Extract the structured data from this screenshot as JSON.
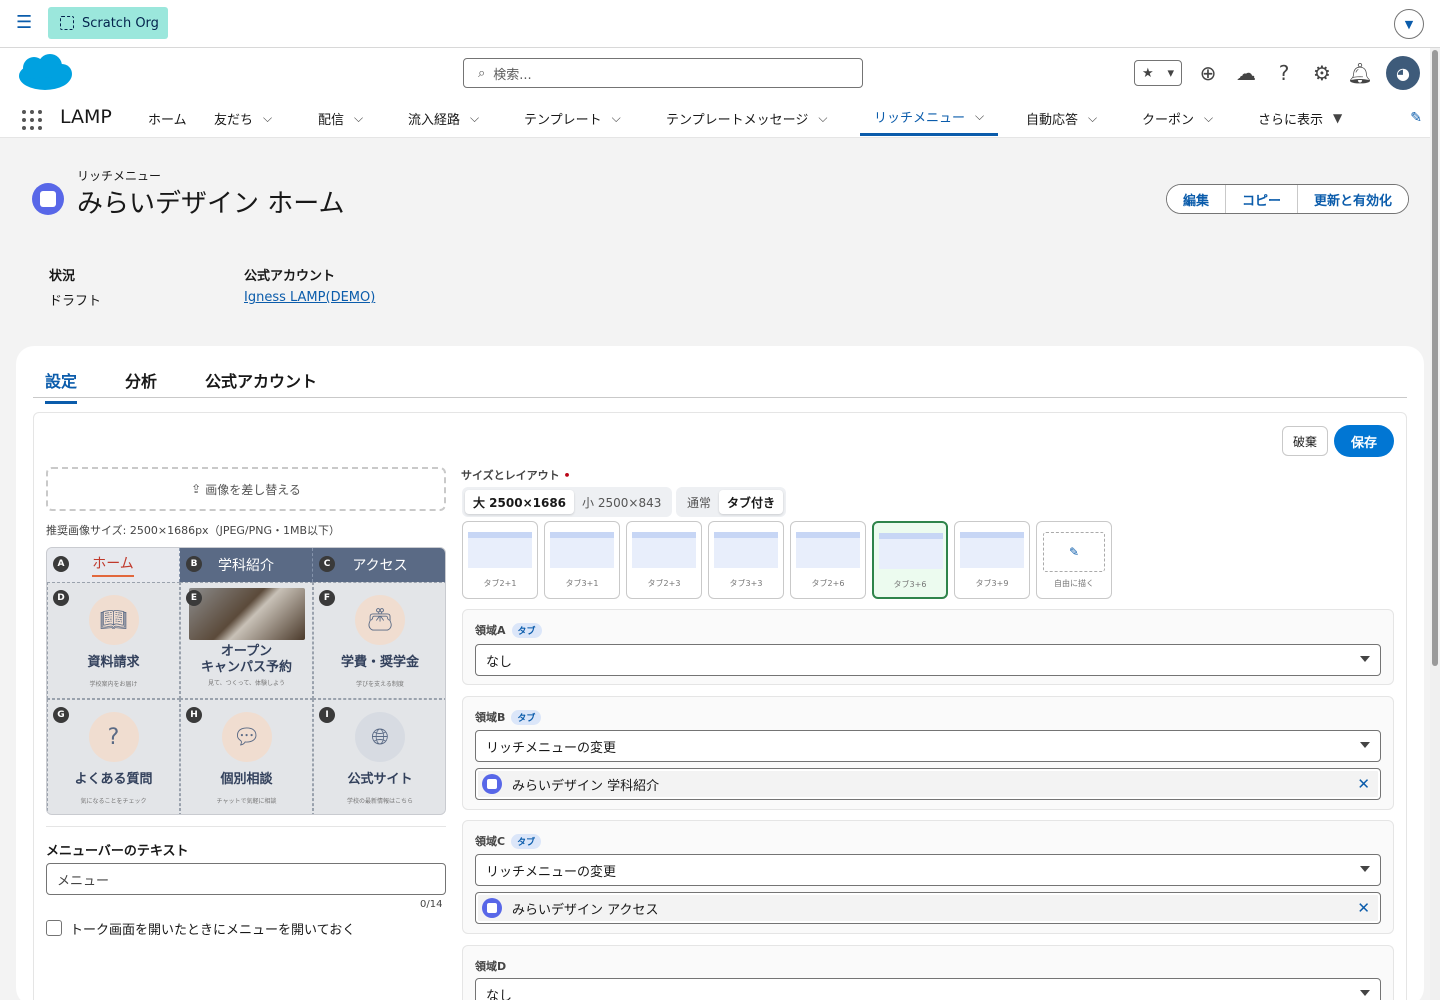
{
  "topbar": {
    "org_label": "Scratch Org"
  },
  "header": {
    "search_placeholder": "検索...",
    "app_name": "LAMP"
  },
  "nav": {
    "items": [
      {
        "label": "ホーム",
        "has_menu": false
      },
      {
        "label": "友だち",
        "has_menu": true
      },
      {
        "label": "配信",
        "has_menu": true
      },
      {
        "label": "流入経路",
        "has_menu": true
      },
      {
        "label": "テンプレート",
        "has_menu": true
      },
      {
        "label": "テンプレートメッセージ",
        "has_menu": true
      },
      {
        "label": "リッチメニュー",
        "has_menu": true,
        "active": true
      },
      {
        "label": "自動応答",
        "has_menu": true
      },
      {
        "label": "クーポン",
        "has_menu": true
      },
      {
        "label": "さらに表示",
        "has_menu": true
      }
    ]
  },
  "record": {
    "type": "リッチメニュー",
    "title": "みらいデザイン ホーム",
    "actions": [
      "編集",
      "コピー",
      "更新と有効化"
    ],
    "fields": [
      {
        "label": "状況",
        "value": "ドラフト"
      },
      {
        "label": "公式アカウント",
        "value": "Igness LAMP(DEMO)"
      }
    ]
  },
  "tabs": [
    "設定",
    "分析",
    "公式アカウント"
  ],
  "buttons": {
    "discard": "破棄",
    "save": "保存"
  },
  "image": {
    "replace_label": "画像を差し替える",
    "hint": "推奨画像サイズ: 2500×1686px（JPEG/PNG・1MB以下）"
  },
  "menu_preview": {
    "tabs": [
      {
        "badge": "A",
        "label": "ホーム"
      },
      {
        "badge": "B",
        "label": "学科紹介"
      },
      {
        "badge": "C",
        "label": "アクセス"
      }
    ],
    "cells": [
      {
        "badge": "D",
        "label": "資料請求",
        "sub": "学校案内をお届け"
      },
      {
        "badge": "E",
        "label": "オープン\nキャンパス予約",
        "sub": "見て、つくって、体験しよう"
      },
      {
        "badge": "F",
        "label": "学費・奨学金",
        "sub": "学びを支える制度"
      },
      {
        "badge": "G",
        "label": "よくある質問",
        "sub": "気になることをチェック"
      },
      {
        "badge": "H",
        "label": "個別相談",
        "sub": "チャットで気軽に相談"
      },
      {
        "badge": "I",
        "label": "公式サイト",
        "sub": "学校の最新情報はこちら"
      }
    ]
  },
  "menubar": {
    "label": "メニューバーのテキスト",
    "value": "メニュー",
    "counter": "0/14",
    "open_label": "トーク画面を開いたときにメニューを開いておく"
  },
  "size_layout": {
    "label": "サイズとレイアウト",
    "sizes": [
      {
        "label": "大 2500×1686",
        "selected": true
      },
      {
        "label": "小 2500×843",
        "selected": false
      }
    ],
    "modes": [
      {
        "label": "通常",
        "selected": false
      },
      {
        "label": "タブ付き",
        "selected": true
      }
    ],
    "layouts": [
      "タブ2+1",
      "タブ3+1",
      "タブ2+3",
      "タブ3+3",
      "タブ2+6",
      "タブ3+6",
      "タブ3+9",
      "自由に描く"
    ],
    "selected_layout": "タブ3+6"
  },
  "regions": [
    {
      "label": "領域A",
      "pill": "タブ",
      "action": "なし",
      "target": ""
    },
    {
      "label": "領域B",
      "pill": "タブ",
      "action": "リッチメニューの変更",
      "target": "みらいデザイン 学科紹介"
    },
    {
      "label": "領域C",
      "pill": "タブ",
      "action": "リッチメニューの変更",
      "target": "みらいデザイン アクセス"
    },
    {
      "label": "領域D",
      "pill": "",
      "action": "なし",
      "target": ""
    }
  ]
}
